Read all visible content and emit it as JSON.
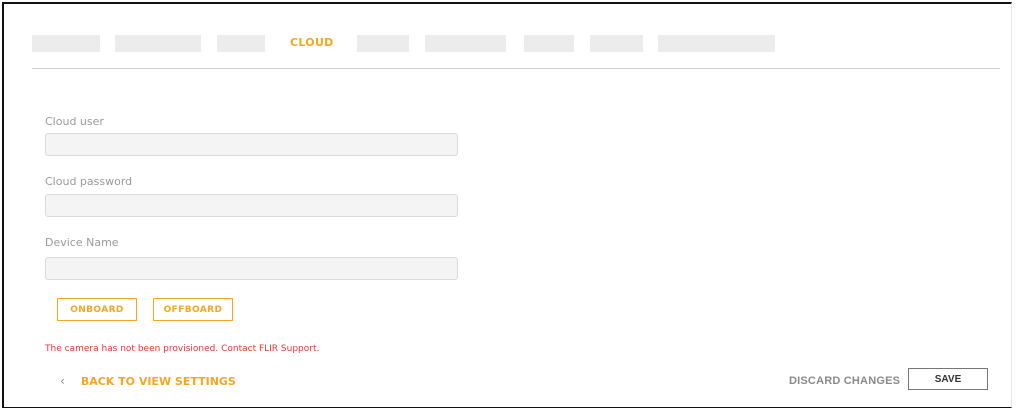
{
  "tabs": {
    "active_label": "CLOUD"
  },
  "form": {
    "cloud_user_label": "Cloud user",
    "cloud_password_label": "Cloud password",
    "device_name_label": "Device Name",
    "cloud_user_value": "",
    "cloud_password_value": "",
    "device_name_value": ""
  },
  "actions": {
    "onboard_label": "ONBOARD",
    "offboard_label": "OFFBOARD"
  },
  "status": {
    "error_text": "The camera has not been provisioned. Contact FLIR Support."
  },
  "footer": {
    "back_label": "BACK TO VIEW SETTINGS",
    "discard_label": "DISCARD CHANGES",
    "save_label": "SAVE"
  },
  "colors": {
    "accent": "#f5a623",
    "error": "#e53935",
    "field_bg": "#f4f4f4"
  }
}
